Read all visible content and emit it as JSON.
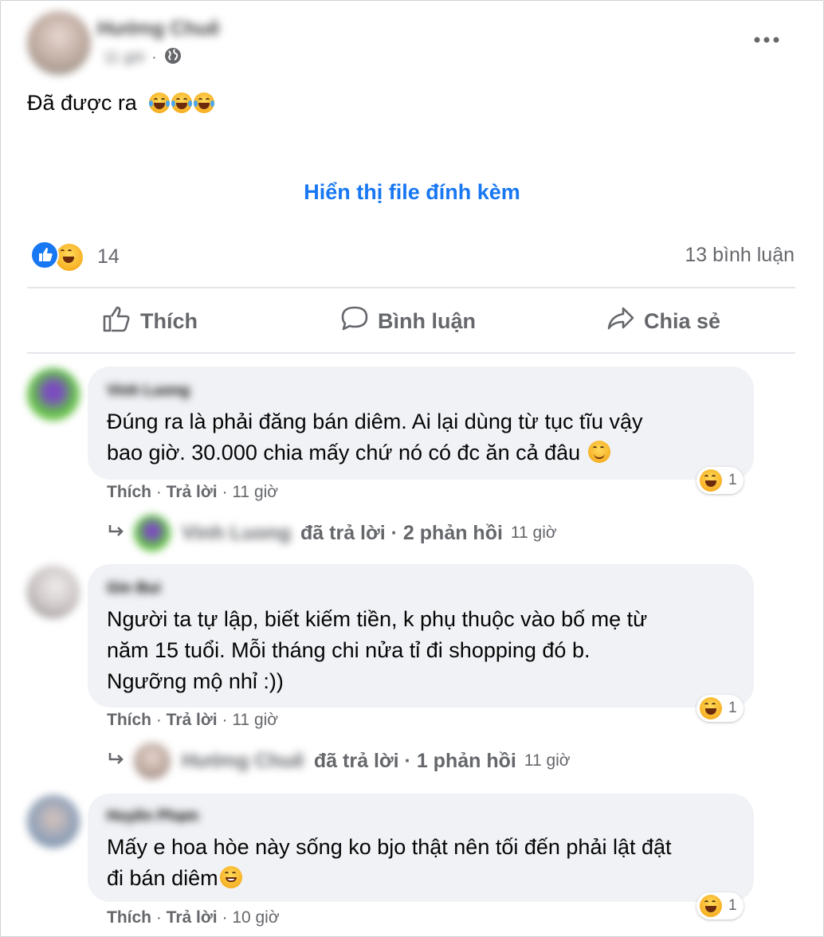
{
  "post": {
    "author_name": "Hường Chuê",
    "time": "11 giờ",
    "globe_icon": "globe-icon",
    "more_icon": "more-options-icon",
    "text": "Đã được ra",
    "attachment_link": "Hiển thị file đính kèm",
    "reaction_count": "14",
    "comments_count": "13 bình luận"
  },
  "actions": {
    "like": "Thích",
    "comment": "Bình luận",
    "share": "Chia sẻ"
  },
  "comments": [
    {
      "name": "Vinh Luong",
      "text_line1": "Đúng ra là phải đăng bán diêm. Ai lại dùng từ tục tĩu vậy",
      "text_line2": "bao giờ. 30.000 chia mấy chứ nó có đc ăn cả đâu",
      "like": "Thích",
      "reply": "Trả lời",
      "time": "11 giờ",
      "reaction_count": "1",
      "reply_name": "Vinh Luong",
      "reply_text": "đã trả lời · 2 phản hồi",
      "reply_time": "11 giờ"
    },
    {
      "name": "Gin Bui",
      "text_line1": "Người ta tự lập, biết kiếm tiền, k phụ thuộc vào bố mẹ từ",
      "text_line2": "năm 15 tuổi. Mỗi tháng chi nửa tỉ đi shopping đó b.",
      "text_line3": "Ngưỡng mộ nhỉ :))",
      "like": "Thích",
      "reply": "Trả lời",
      "time": "11 giờ",
      "reaction_count": "1",
      "reply_name": "Hường Chuê",
      "reply_text": "đã trả lời · 1 phản hồi",
      "reply_time": "11 giờ"
    },
    {
      "name": "Huyền Phạm",
      "text_line1": "Mấy e hoa hòe này sống ko bjo thật nên tối đến phải lật đật",
      "text_line2": "đi bán diêm",
      "like": "Thích",
      "reply": "Trả lời",
      "time": "10 giờ",
      "reaction_count": "1"
    }
  ],
  "colors": {
    "link_blue": "#1877f2",
    "secondary_text": "#65676b",
    "bubble_bg": "#f0f2f5"
  }
}
